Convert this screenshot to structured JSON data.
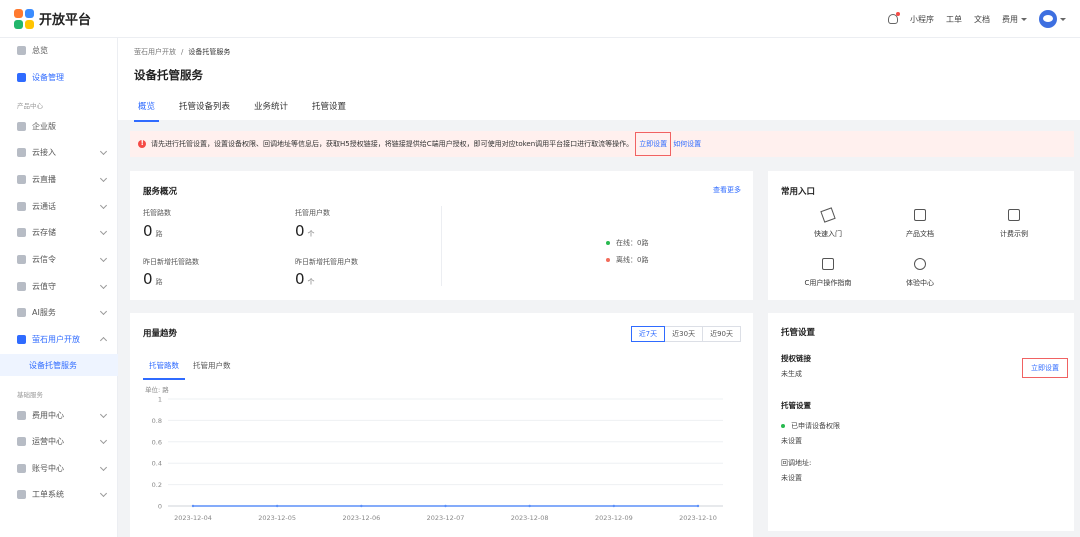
{
  "app": {
    "name": "开放平台"
  },
  "topbar": {
    "links": [
      "小程序",
      "工单",
      "文档",
      "费用"
    ]
  },
  "sidebar": {
    "items": [
      {
        "label": "总览",
        "top": 0
      },
      {
        "label": "设备管理"
      },
      {
        "group": "产品中心"
      },
      {
        "label": "企业版"
      },
      {
        "label": "云接入"
      },
      {
        "label": "云直播"
      },
      {
        "label": "云通话"
      },
      {
        "label": "云存储"
      },
      {
        "label": "云信令"
      },
      {
        "label": "云值守"
      },
      {
        "label": "AI服务"
      },
      {
        "label": "萤石用户开放"
      },
      {
        "label": "设备托管服务"
      },
      {
        "group": "基础服务"
      },
      {
        "label": "费用中心"
      },
      {
        "label": "运营中心"
      },
      {
        "label": "账号中心"
      },
      {
        "label": "工单系统"
      }
    ]
  },
  "breadcrumb": {
    "parent": "萤石用户开放",
    "sep": "/",
    "current": "设备托管服务"
  },
  "page": {
    "title": "设备托管服务"
  },
  "tabs": [
    "概览",
    "托管设备列表",
    "业务统计",
    "托管设置"
  ],
  "alert": {
    "text": "请先进行托管设置，设置设备权限、回调地址等信息后，获取H5授权链接，将链接提供给C端用户授权，即可使用对应token调用平台接口进行取流等操作。",
    "link1": "立即设置",
    "link2": "如何设置"
  },
  "overview": {
    "title": "服务概况",
    "more": "查看更多",
    "stats": [
      {
        "label": "托管路数",
        "value": "0",
        "unit": "路"
      },
      {
        "label": "托管用户数",
        "value": "0",
        "unit": "个"
      },
      {
        "label": "昨日新增托管路数",
        "value": "0",
        "unit": "路"
      },
      {
        "label": "昨日新增托管用户数",
        "value": "0",
        "unit": "个"
      }
    ],
    "online": "在线：0路",
    "offline": "离线：0路",
    "colors": {
      "online": "#29b94f",
      "offline": "#f26b5a"
    }
  },
  "entries": {
    "title": "常用入口",
    "items": [
      "快速入门",
      "产品文档",
      "计费示例",
      "C用户操作指南",
      "体验中心"
    ]
  },
  "usage": {
    "title": "用量趋势",
    "ranges": [
      "近7天",
      "近30天",
      "近90天"
    ],
    "sub_tabs": [
      "托管路数",
      "托管用户数"
    ],
    "unit": "单位: 路"
  },
  "chart_data": {
    "type": "line",
    "x": [
      "2023-12-04",
      "2023-12-05",
      "2023-12-06",
      "2023-12-07",
      "2023-12-08",
      "2023-12-09",
      "2023-12-10"
    ],
    "series": [
      {
        "values": [
          0,
          0,
          0,
          0,
          0,
          0,
          0
        ]
      }
    ],
    "yticks": [
      "1",
      "0.8",
      "0.6",
      "0.4",
      "0.2",
      "0"
    ],
    "ylim": [
      0,
      1
    ],
    "grid": true,
    "color": "#5b8ff9"
  },
  "hosting": {
    "title": "托管设置",
    "set_btn": "立即设置",
    "auth_title": "授权链接",
    "auth_value": "未生成",
    "settings_title": "托管设置",
    "perm_label": "已申请设备权限",
    "perm_value": "未设置",
    "callback_label": "回调地址:",
    "callback_value": "未设置"
  }
}
